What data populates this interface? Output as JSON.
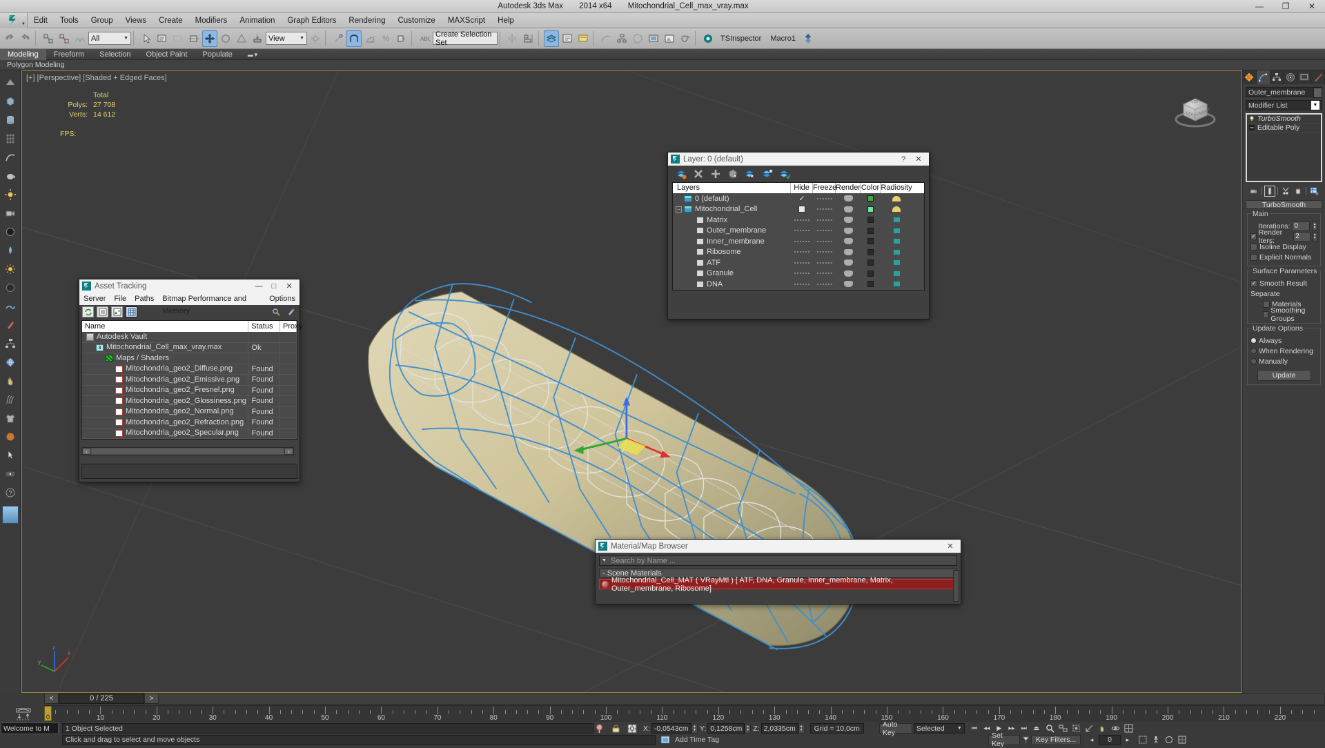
{
  "window": {
    "app_name": "Autodesk 3ds Max",
    "version": "2014 x64",
    "file_name": "Mitochondrial_Cell_max_vray.max",
    "minimize": "—",
    "maximize": "❐",
    "close": "✕"
  },
  "menu": {
    "items": [
      "Edit",
      "Tools",
      "Group",
      "Views",
      "Create",
      "Modifiers",
      "Animation",
      "Graph Editors",
      "Rendering",
      "Customize",
      "MAXScript",
      "Help"
    ]
  },
  "toolbar": {
    "selection_filter": "All",
    "reference_coord": "View",
    "named_selection_set": "Create Selection Set",
    "tsinspector": "TSInspector",
    "macro": "Macro1"
  },
  "ribbon": {
    "tabs": [
      {
        "label": "Modeling",
        "active": true
      },
      {
        "label": "Freeform",
        "active": false
      },
      {
        "label": "Selection",
        "active": false
      },
      {
        "label": "Object Paint",
        "active": false
      },
      {
        "label": "Populate",
        "active": false
      }
    ],
    "subrow_label": "Polygon Modeling"
  },
  "viewport": {
    "label": "[+] [Perspective] [Shaded + Edged Faces]",
    "stats": {
      "total_header": "Total",
      "polys_label": "Polys:",
      "polys_value": "27 708",
      "verts_label": "Verts:",
      "verts_value": "14 612",
      "fps_label": "FPS:",
      "fps_value": ""
    },
    "axis": {
      "x": "x",
      "y": "y",
      "z": "z"
    },
    "viewcube": {
      "top": "TOP",
      "left": "LEFT",
      "front": "FRONT"
    }
  },
  "asset_tracking": {
    "title": "Asset Tracking",
    "menu": [
      "Server",
      "File",
      "Paths",
      "Bitmap Performance and Memory",
      "Options"
    ],
    "columns": [
      "Name",
      "Status",
      "Proxy"
    ],
    "rows": [
      {
        "name": "Autodesk Vault",
        "status": "",
        "icon": "vault-icon",
        "indent": 0
      },
      {
        "name": "Mitochondrial_Cell_max_vray.max",
        "status": "Ok",
        "icon": "max-file-icon",
        "indent": 1
      },
      {
        "name": "Maps / Shaders",
        "status": "",
        "icon": "maps-shaders-icon",
        "indent": 2
      },
      {
        "name": "Mitochondria_geo2_Diffuse.png",
        "status": "Found",
        "icon": "png-icon",
        "indent": 3
      },
      {
        "name": "Mitochondria_geo2_Emissive.png",
        "status": "Found",
        "icon": "png-icon",
        "indent": 3
      },
      {
        "name": "Mitochondria_geo2_Fresnel.png",
        "status": "Found",
        "icon": "png-icon",
        "indent": 3
      },
      {
        "name": "Mitochondria_geo2_Glossiness.png",
        "status": "Found",
        "icon": "png-icon",
        "indent": 3
      },
      {
        "name": "Mitochondria_geo2_Normal.png",
        "status": "Found",
        "icon": "png-icon",
        "indent": 3
      },
      {
        "name": "Mitochondria_geo2_Refraction.png",
        "status": "Found",
        "icon": "png-icon",
        "indent": 3
      },
      {
        "name": "Mitochondria_geo2_Specular.png",
        "status": "Found",
        "icon": "png-icon",
        "indent": 3
      }
    ],
    "minimize": "—",
    "maximize": "□",
    "close": "✕",
    "scroll_left": "‹",
    "scroll_right": "›"
  },
  "layer_dialog": {
    "title": "Layer: 0 (default)",
    "help": "?",
    "close": "✕",
    "columns": [
      "Layers",
      "Hide",
      "Freeze",
      "Render",
      "Color",
      "Radiosity"
    ],
    "rows": [
      {
        "name": "0 (default)",
        "indent": 1,
        "icon": "layer-icon",
        "current": true,
        "color": "#3fa83f",
        "radiosity": "on",
        "expander": ""
      },
      {
        "name": "Mitochondrial_Cell",
        "indent": 1,
        "icon": "layer-icon",
        "checkbox": true,
        "color": "#64e6a0",
        "radiosity": "on",
        "expander": "−"
      },
      {
        "name": "Matrix",
        "indent": 2,
        "icon": "object-icon",
        "color": "#2b2b2b",
        "radiosity": "off",
        "expander": ""
      },
      {
        "name": "Outer_membrane",
        "indent": 2,
        "icon": "object-icon",
        "color": "#2b2b2b",
        "radiosity": "off",
        "expander": ""
      },
      {
        "name": "Inner_membrane",
        "indent": 2,
        "icon": "object-icon",
        "color": "#2b2b2b",
        "radiosity": "off",
        "expander": ""
      },
      {
        "name": "Ribosome",
        "indent": 2,
        "icon": "object-icon",
        "color": "#2b2b2b",
        "radiosity": "off",
        "expander": ""
      },
      {
        "name": "ATF",
        "indent": 2,
        "icon": "object-icon",
        "color": "#2b2b2b",
        "radiosity": "off",
        "expander": ""
      },
      {
        "name": "Granule",
        "indent": 2,
        "icon": "object-icon",
        "color": "#2b2b2b",
        "radiosity": "off",
        "expander": ""
      },
      {
        "name": "DNA",
        "indent": 2,
        "icon": "object-icon",
        "color": "#2b2b2b",
        "radiosity": "off",
        "expander": ""
      }
    ]
  },
  "material_browser": {
    "title": "Material/Map Browser",
    "close": "✕",
    "search_placeholder": "Search by Name ...",
    "section": "- Scene Materials",
    "entry": "Mitochondrial_Cell_MAT  ( VRayMtl )  [ ATF, DNA, Granule, Inner_membrane, Matrix, Outer_membrane, Ribosome]",
    "highlight_color": "#8f2020"
  },
  "command_panel": {
    "tabs": [
      "create-tab",
      "modify-tab",
      "hierarchy-tab",
      "motion-tab",
      "display-tab",
      "utilities-tab"
    ],
    "active_tab_index": 1,
    "object_name": "Outer_membrane",
    "modifier_list_label": "Modifier List",
    "stack": [
      {
        "label": "TurboSmooth",
        "italic": true
      },
      {
        "label": "Editable Poly",
        "italic": false
      }
    ],
    "rollout_title": "TurboSmooth",
    "groups": [
      {
        "title": "Main",
        "rows": [
          {
            "type": "spinner",
            "label": "Iterations:",
            "value": "0",
            "checkbox": null
          },
          {
            "type": "spinner",
            "label": "Render Iters:",
            "value": "2",
            "checkbox": true
          },
          {
            "type": "check",
            "label": "Isoline Display",
            "checked": false
          },
          {
            "type": "check",
            "label": "Explicit Normals",
            "checked": false
          }
        ]
      },
      {
        "title": "Surface Parameters",
        "rows": [
          {
            "type": "check",
            "label": "Smooth Result",
            "checked": true
          },
          {
            "type": "text",
            "label": "Separate"
          },
          {
            "type": "check",
            "label": "Materials",
            "checked": false,
            "indent": true
          },
          {
            "type": "check",
            "label": "Smoothing Groups",
            "checked": false,
            "indent": true
          }
        ]
      },
      {
        "title": "Update Options",
        "rows": [
          {
            "type": "radio",
            "label": "Always",
            "checked": true
          },
          {
            "type": "radio",
            "label": "When Rendering",
            "checked": false
          },
          {
            "type": "radio",
            "label": "Manually",
            "checked": false
          }
        ],
        "button": "Update"
      }
    ]
  },
  "timeline": {
    "prev": "<",
    "next": ">",
    "frame_display": "0 / 225",
    "tick_labels": [
      "0",
      "10",
      "20",
      "30",
      "40",
      "50",
      "60",
      "70",
      "80",
      "90",
      "100",
      "110",
      "120",
      "130",
      "140",
      "150",
      "160",
      "170",
      "180",
      "190",
      "200",
      "210",
      "220"
    ],
    "current_frame": "0"
  },
  "status_bar": {
    "selection_text": "1 Object Selected",
    "prompt_text": "Click and drag to select and move objects",
    "welcome_text": "Welcome to M",
    "coords": {
      "x_label": "X:",
      "x_value": "-0,0543cm",
      "y_label": "Y:",
      "y_value": "0,1258cm",
      "z_label": "Z:",
      "z_value": "2,0335cm"
    },
    "grid_text": "Grid = 10,0cm",
    "auto_key": "Auto Key",
    "set_key": "Set Key",
    "key_filters": "Key Filters...",
    "selected_dropdown": "Selected",
    "key_value": "0",
    "add_time_tag": "Add Time Tag"
  },
  "colors": {
    "viewport_bg": "#3c3c3c",
    "panel_bg": "#3d3d3d",
    "accent_yellow": "#9d8b38",
    "stats_yellow": "#e2cf6a",
    "wireframe_blue": "#3f8fd0",
    "wireframe_white": "#e8e8e8",
    "mesh_tan": "#cfc49a",
    "highlight_red": "#8f2020"
  }
}
